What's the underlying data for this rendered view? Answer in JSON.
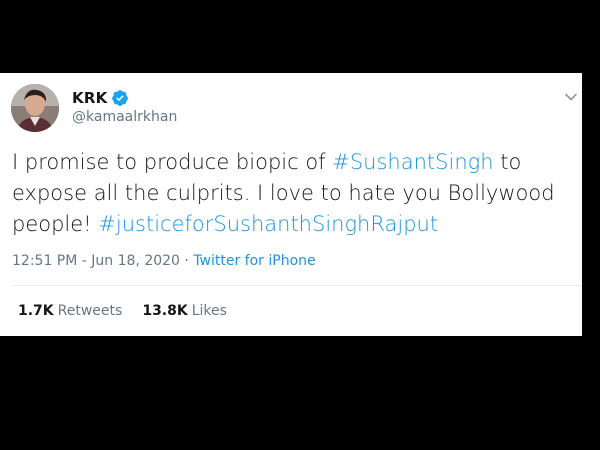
{
  "tweet": {
    "display_name": "KRK",
    "handle": "@kamaalrkhan",
    "verified": true,
    "text_lines": {
      "part1": "I promise to produce biopic of ",
      "hashtag1": "#SushantSingh",
      "part2": " to expose all the culprits. I love to hate you Bollywood people! ",
      "hashtag2": "#justiceforSushanthSinghRajput"
    },
    "time": "12:51 PM",
    "separator": " · ",
    "date": "Jun 18, 2020",
    "source": "Twitter for iPhone",
    "stats": {
      "retweets_count": "1.7K",
      "retweets_label": "Retweets",
      "likes_count": "13.8K",
      "likes_label": "Likes"
    }
  },
  "colors": {
    "background": "#000000",
    "card": "#ffffff",
    "link": "#1b95e0",
    "secondary_text": "#657786",
    "primary_text": "#14171a",
    "divider": "#e6ecf0"
  },
  "icons": {
    "verified": "verified-badge-icon",
    "caret": "chevron-down-icon"
  }
}
